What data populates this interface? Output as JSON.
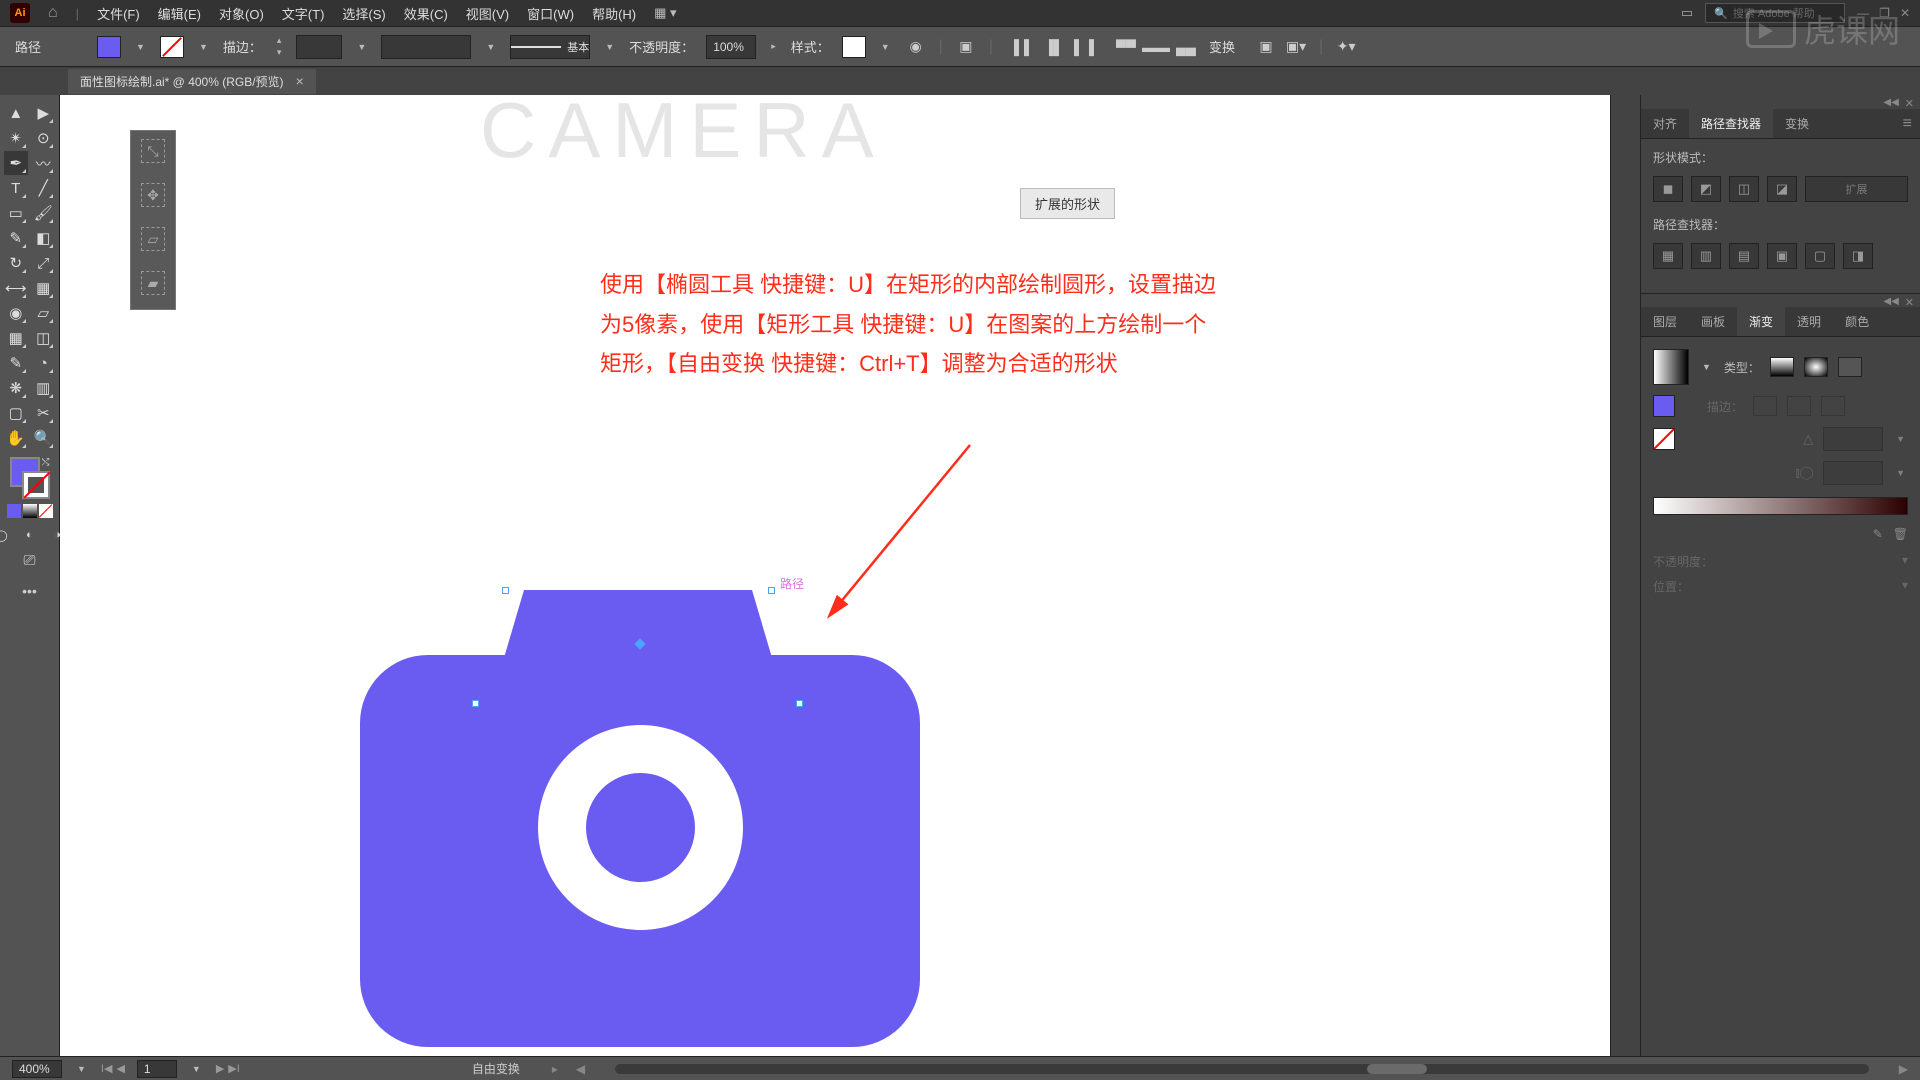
{
  "menubar": {
    "items": [
      "文件(F)",
      "编辑(E)",
      "对象(O)",
      "文字(T)",
      "选择(S)",
      "效果(C)",
      "视图(V)",
      "窗口(W)",
      "帮助(H)"
    ],
    "search_placeholder": "搜索 Adobe 帮助"
  },
  "controlbar": {
    "path_label": "路径",
    "stroke_label": "描边：",
    "opacity_label": "不透明度：",
    "opacity_value": "100%",
    "style_label": "样式：",
    "profile_label": "基本",
    "transform_label": "变换",
    "fill_color": "#6a5cf0"
  },
  "doctab": {
    "title": "面性图标绘制.ai* @ 400% (RGB/预览)"
  },
  "canvas": {
    "badge": "扩展的形状",
    "heading_ghost": "CAMERA",
    "tutorial_lines": [
      "使用【椭圆工具 快捷键：U】在矩形的内部绘制圆形，设置描边",
      "为5像素，使用【矩形工具 快捷键：U】在图案的上方绘制一个",
      "矩形，【自由变换 快捷键：Ctrl+T】调整为合适的形状"
    ],
    "path_label": "路径",
    "camera_color": "#6a5cf0"
  },
  "right": {
    "align_tabs": [
      "对齐",
      "路径查找器",
      "变换"
    ],
    "shape_mode_label": "形状模式：",
    "pathfinder_label": "路径查找器：",
    "expand_label": "扩展",
    "grad_tabs": [
      "图层",
      "画板",
      "渐变",
      "透明",
      "颜色"
    ],
    "type_label": "类型：",
    "stroke_label_grad": "描边：",
    "angle_icon": "△",
    "opacity_label": "不透明度：",
    "position_label": "位置："
  },
  "statusbar": {
    "zoom": "400%",
    "artboard": "1",
    "tool": "自由变换"
  },
  "watermark": "虎课网"
}
